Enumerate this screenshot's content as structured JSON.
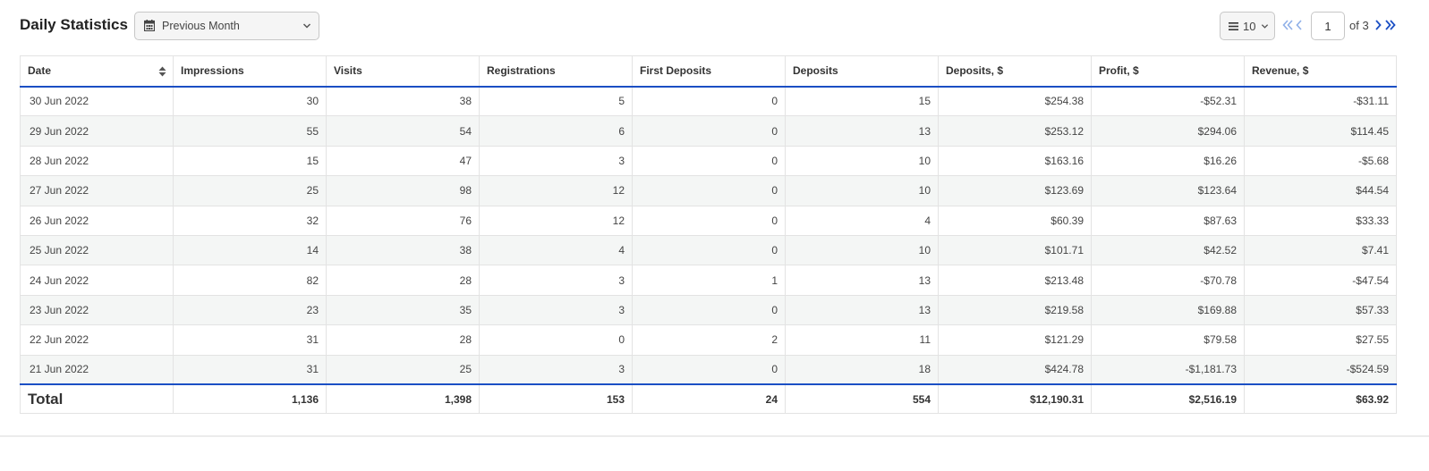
{
  "header": {
    "title": "Daily Statistics",
    "period_label": "Previous Month"
  },
  "pagination": {
    "per_page": "10",
    "current_page": "1",
    "total_pages_text": "of 3"
  },
  "table": {
    "columns": [
      "Date",
      "Impressions",
      "Visits",
      "Registrations",
      "First Deposits",
      "Deposits",
      "Deposits, $",
      "Profit, $",
      "Revenue, $"
    ],
    "rows": [
      [
        "30 Jun 2022",
        "30",
        "38",
        "5",
        "0",
        "15",
        "$254.38",
        "-$52.31",
        "-$31.11"
      ],
      [
        "29 Jun 2022",
        "55",
        "54",
        "6",
        "0",
        "13",
        "$253.12",
        "$294.06",
        "$114.45"
      ],
      [
        "28 Jun 2022",
        "15",
        "47",
        "3",
        "0",
        "10",
        "$163.16",
        "$16.26",
        "-$5.68"
      ],
      [
        "27 Jun 2022",
        "25",
        "98",
        "12",
        "0",
        "10",
        "$123.69",
        "$123.64",
        "$44.54"
      ],
      [
        "26 Jun 2022",
        "32",
        "76",
        "12",
        "0",
        "4",
        "$60.39",
        "$87.63",
        "$33.33"
      ],
      [
        "25 Jun 2022",
        "14",
        "38",
        "4",
        "0",
        "10",
        "$101.71",
        "$42.52",
        "$7.41"
      ],
      [
        "24 Jun 2022",
        "82",
        "28",
        "3",
        "1",
        "13",
        "$213.48",
        "-$70.78",
        "-$47.54"
      ],
      [
        "23 Jun 2022",
        "23",
        "35",
        "3",
        "0",
        "13",
        "$219.58",
        "$169.88",
        "$57.33"
      ],
      [
        "22 Jun 2022",
        "31",
        "28",
        "0",
        "2",
        "11",
        "$121.29",
        "$79.58",
        "$27.55"
      ],
      [
        "21 Jun 2022",
        "31",
        "25",
        "3",
        "0",
        "18",
        "$424.78",
        "-$1,181.73",
        "-$524.59"
      ]
    ],
    "totals": [
      "Total",
      "1,136",
      "1,398",
      "153",
      "24",
      "554",
      "$12,190.31",
      "$2,516.19",
      "$63.92"
    ]
  },
  "icons": {
    "period": "calendar-icon",
    "period_dropdown": "chevron-down-icon",
    "per_page": "list-lines-icon",
    "sort": "sort-icon",
    "first_page": "double-chevron-left-icon",
    "prev_page": "chevron-left-icon",
    "next_page": "chevron-right-icon",
    "last_page": "double-chevron-right-icon"
  },
  "colors": {
    "accent": "#1b4fc4",
    "pager_disabled": "#8fb0e8",
    "pager_active": "#1b4fc4",
    "row_stripe": "#f4f6f5"
  }
}
